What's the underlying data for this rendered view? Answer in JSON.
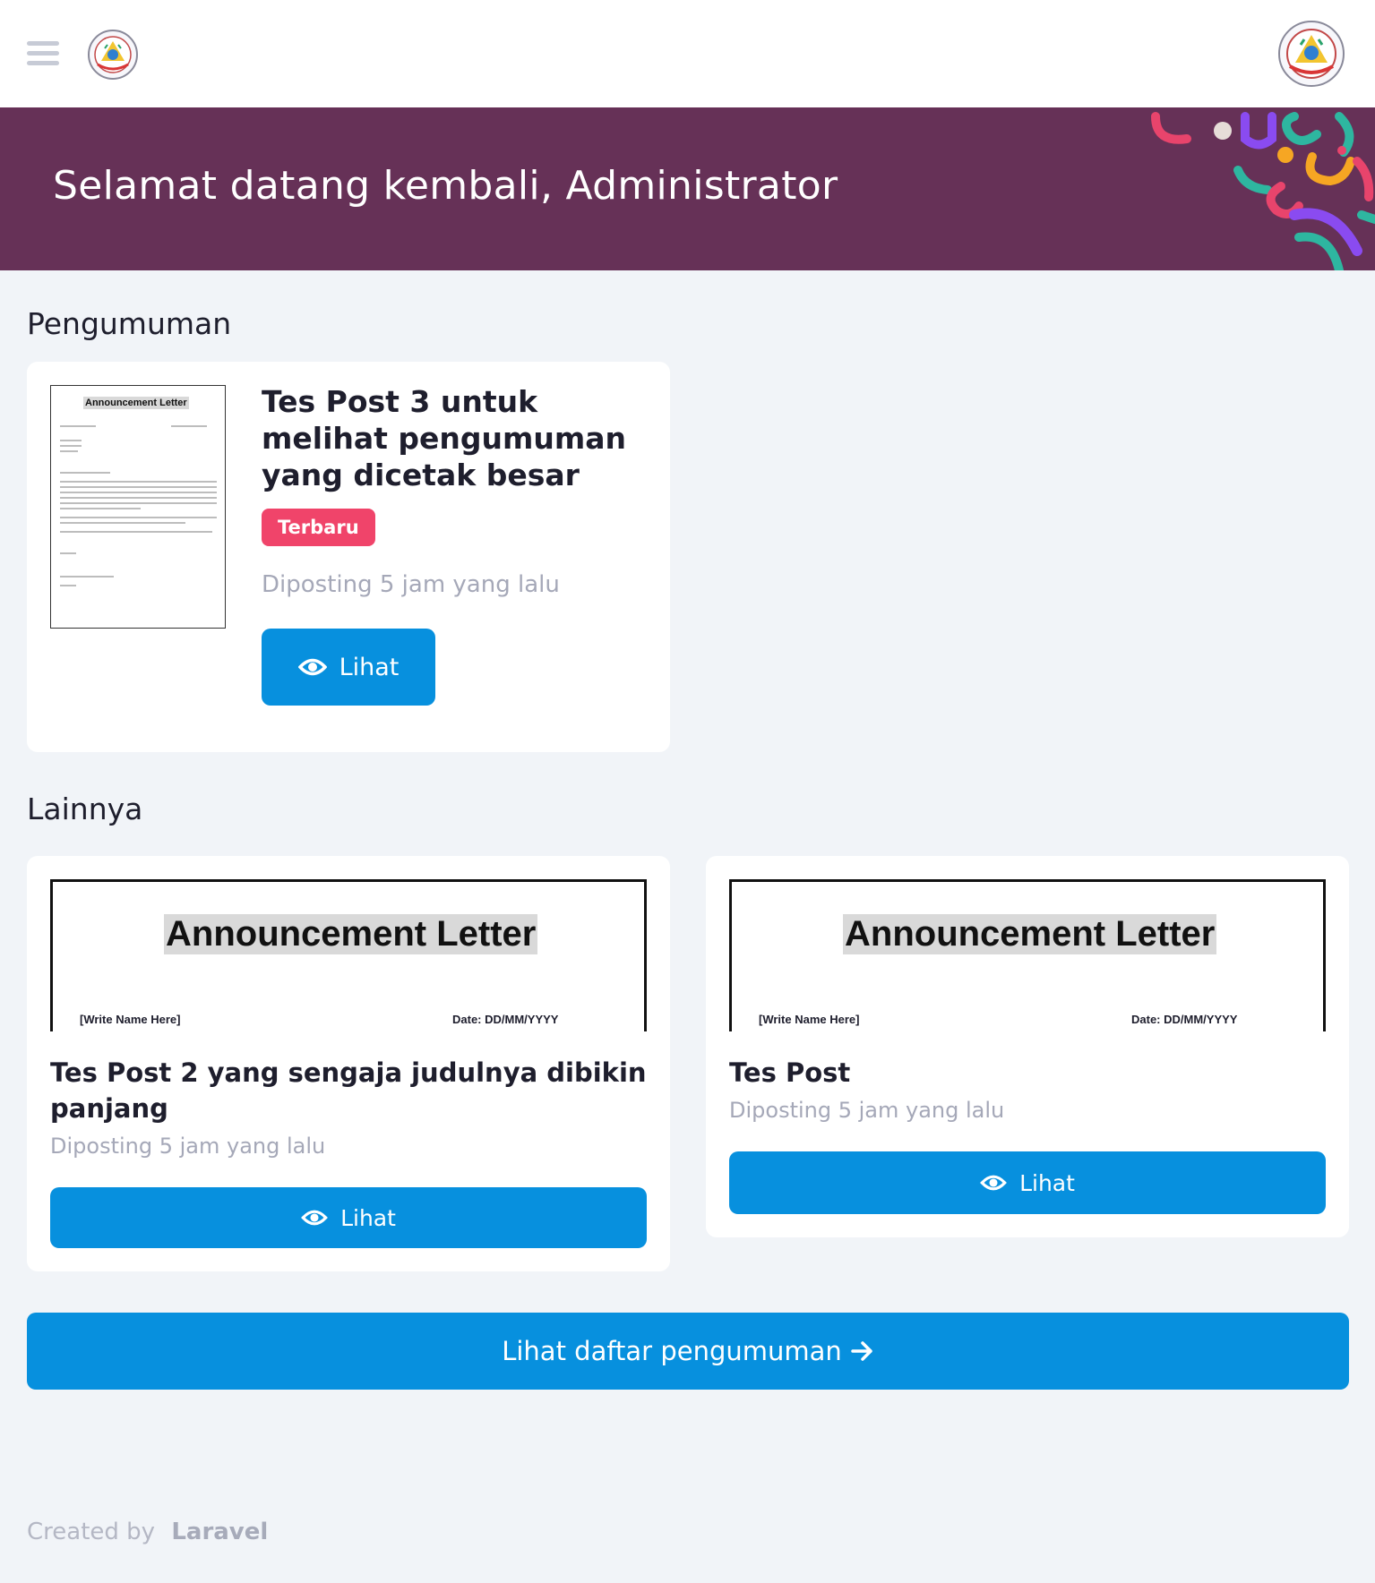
{
  "navbar": {
    "menu_icon": "hamburger-icon",
    "left_logo": "school-emblem",
    "right_logo": "school-emblem-avatar"
  },
  "banner": {
    "title": "Selamat datang kembali, Administrator",
    "background_color": "#663157"
  },
  "announcements": {
    "heading": "Pengumuman",
    "featured": {
      "thumbnail_title": "Announcement Letter",
      "title": "Tes Post 3 untuk melihat pengumuman yang dicetak besar",
      "badge": "Terbaru",
      "posted": "Diposting 5 jam yang lalu",
      "button_label": "Lihat",
      "button_icon": "eye-icon"
    }
  },
  "others": {
    "heading": "Lainnya",
    "items": [
      {
        "thumbnail_title": "Announcement Letter",
        "thumbnail_name": "[Write Name Here]",
        "thumbnail_date": "Date: DD/MM/YYYY",
        "title": "Tes Post 2 yang sengaja judulnya dibikin panjang",
        "posted": "Diposting 5 jam yang lalu",
        "button_label": "Lihat",
        "button_icon": "eye-icon"
      },
      {
        "thumbnail_title": "Announcement Letter",
        "thumbnail_name": "[Write Name Here]",
        "thumbnail_date": "Date: DD/MM/YYYY",
        "title": "Tes Post",
        "posted": "Diposting 5 jam yang lalu",
        "button_label": "Lihat",
        "button_icon": "eye-icon"
      }
    ]
  },
  "all_button": {
    "label": "Lihat daftar pengumuman",
    "icon": "arrow-right-icon"
  },
  "footer": {
    "prefix": "Created by",
    "brand": "Laravel"
  },
  "colors": {
    "primary": "#0790de",
    "badge": "#f0446a",
    "banner": "#663157",
    "background": "#f1f4f8"
  }
}
